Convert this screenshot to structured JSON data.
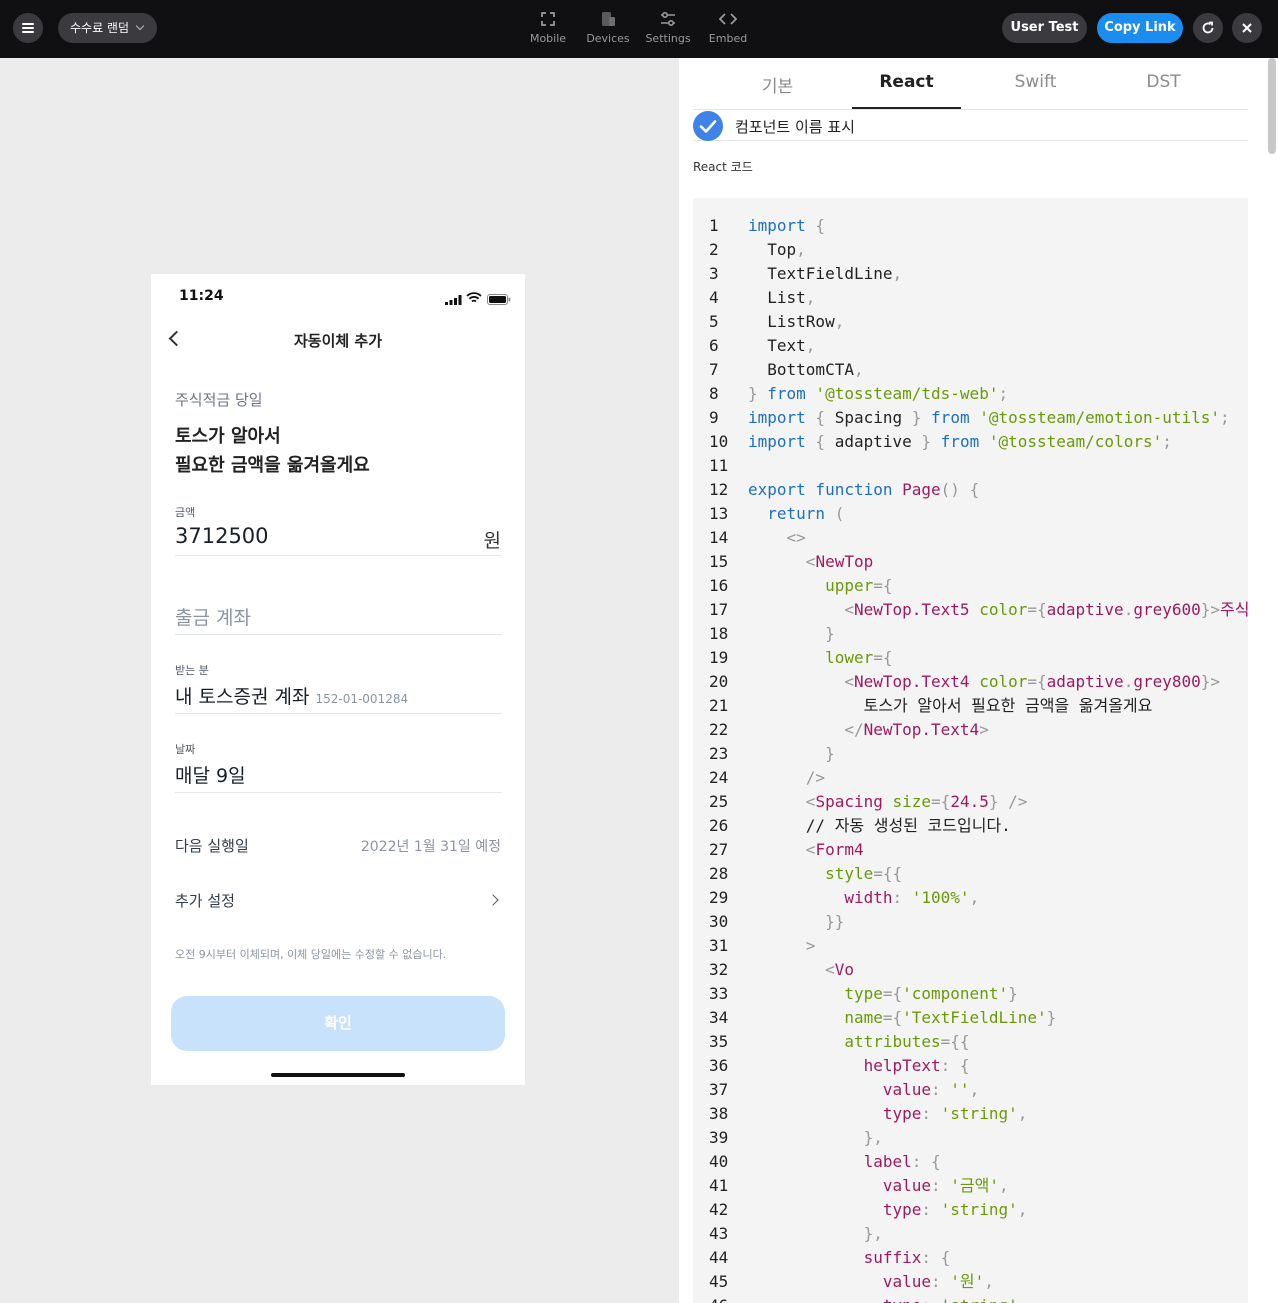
{
  "topbar": {
    "project_name": "수수료 랜덤",
    "tools": [
      {
        "label": "Mobile",
        "icon": "expand-icon"
      },
      {
        "label": "Devices",
        "icon": "devices-icon"
      },
      {
        "label": "Settings",
        "icon": "settings-sliders-icon"
      },
      {
        "label": "Embed",
        "icon": "code-brackets-icon"
      }
    ],
    "user_test_label": "User Test",
    "copy_link_label": "Copy Link"
  },
  "phone": {
    "status_time": "11:24",
    "nav_title": "자동이체 추가",
    "upper_text": "주식적금 당일",
    "lower_text_1": "토스가 알아서",
    "lower_text_2": "필요한 금액을 옮겨올게요",
    "amount_label": "금액",
    "amount_value": "3712500",
    "amount_suffix": "원",
    "withdraw_placeholder": "출금 계좌",
    "receiver_label": "받는 분",
    "receiver_value": "내 토스증권 계좌",
    "receiver_account": "152-01-001284",
    "date_label": "날짜",
    "date_value": "매달 9일",
    "next_run_label": "다음 실행일",
    "next_run_value": "2022년 1월 31일 예정",
    "extra_settings_label": "추가 설정",
    "notice": "오전 9시부터 이체되며, 이체 당일에는 수정할 수 없습니다.",
    "cta_label": "확인"
  },
  "panel": {
    "tabs": [
      "기본",
      "React",
      "Swift",
      "DST"
    ],
    "active_tab": "React",
    "show_component_names_label": "컴포넌트 이름 표시",
    "show_component_names_checked": true,
    "code_label": "React 코드"
  },
  "code_lines": [
    [
      [
        "k",
        "import"
      ],
      [
        "p",
        " {"
      ]
    ],
    [
      [
        "",
        "  Top"
      ],
      [
        "p",
        ","
      ]
    ],
    [
      [
        "",
        "  TextFieldLine"
      ],
      [
        "p",
        ","
      ]
    ],
    [
      [
        "",
        "  List"
      ],
      [
        "p",
        ","
      ]
    ],
    [
      [
        "",
        "  ListRow"
      ],
      [
        "p",
        ","
      ]
    ],
    [
      [
        "",
        "  Text"
      ],
      [
        "p",
        ","
      ]
    ],
    [
      [
        "",
        "  BottomCTA"
      ],
      [
        "p",
        ","
      ]
    ],
    [
      [
        "p",
        "} "
      ],
      [
        "k",
        "from"
      ],
      [
        "",
        ""
      ],
      [
        "s",
        " '@tossteam/tds-web'"
      ],
      [
        "p",
        ";"
      ]
    ],
    [
      [
        "k",
        "import"
      ],
      [
        "p",
        " { "
      ],
      [
        "",
        "Spacing"
      ],
      [
        "p",
        " } "
      ],
      [
        "k",
        "from"
      ],
      [
        "s",
        " '@tossteam/emotion-utils'"
      ],
      [
        "p",
        ";"
      ]
    ],
    [
      [
        "k",
        "import"
      ],
      [
        "p",
        " { "
      ],
      [
        "",
        "adaptive"
      ],
      [
        "p",
        " } "
      ],
      [
        "k",
        "from"
      ],
      [
        "s",
        " '@tossteam/colors'"
      ],
      [
        "p",
        ";"
      ]
    ],
    [],
    [
      [
        "k",
        "export function"
      ],
      [
        "t",
        " Page"
      ],
      [
        "p",
        "() {"
      ]
    ],
    [
      [
        "k",
        "  return"
      ],
      [
        "p",
        " ("
      ]
    ],
    [
      [
        "p",
        "    <>"
      ]
    ],
    [
      [
        "p",
        "      <"
      ],
      [
        "t",
        "NewTop"
      ]
    ],
    [
      [
        "s",
        "        upper"
      ],
      [
        "p",
        "={"
      ]
    ],
    [
      [
        "p",
        "          <"
      ],
      [
        "t",
        "NewTop.Text5"
      ],
      [
        "s",
        " color"
      ],
      [
        "p",
        "={"
      ],
      [
        "t",
        "adaptive"
      ],
      [
        "p",
        "."
      ],
      [
        "t",
        "grey600"
      ],
      [
        "p",
        "}>"
      ],
      [
        "t",
        "주식적금 당일"
      ]
    ],
    [
      [
        "p",
        "        }"
      ]
    ],
    [
      [
        "s",
        "        lower"
      ],
      [
        "p",
        "={"
      ]
    ],
    [
      [
        "p",
        "          <"
      ],
      [
        "t",
        "NewTop.Text4"
      ],
      [
        "s",
        " color"
      ],
      [
        "p",
        "={"
      ],
      [
        "t",
        "adaptive"
      ],
      [
        "p",
        "."
      ],
      [
        "t",
        "grey800"
      ],
      [
        "p",
        "}>"
      ]
    ],
    [
      [
        "",
        "            토스가 알아서 필요한 금액을 옮겨올게요"
      ]
    ],
    [
      [
        "p",
        "          </"
      ],
      [
        "t",
        "NewTop.Text4"
      ],
      [
        "p",
        ">"
      ]
    ],
    [
      [
        "p",
        "        }"
      ]
    ],
    [
      [
        "p",
        "      />"
      ]
    ],
    [
      [
        "p",
        "      <"
      ],
      [
        "t",
        "Spacing"
      ],
      [
        "s",
        " size"
      ],
      [
        "p",
        "={"
      ],
      [
        "t",
        "24.5"
      ],
      [
        "p",
        "} />"
      ]
    ],
    [
      [
        "",
        "      // 자동 생성된 코드입니다."
      ]
    ],
    [
      [
        "p",
        "      <"
      ],
      [
        "t",
        "Form4"
      ]
    ],
    [
      [
        "s",
        "        style"
      ],
      [
        "p",
        "={{"
      ]
    ],
    [
      [
        "t",
        "          width"
      ],
      [
        "p",
        ": "
      ],
      [
        "s",
        "'100%'"
      ],
      [
        "p",
        ","
      ]
    ],
    [
      [
        "p",
        "        }}"
      ]
    ],
    [
      [
        "p",
        "      >"
      ]
    ],
    [
      [
        "p",
        "        <"
      ],
      [
        "t",
        "Vo"
      ]
    ],
    [
      [
        "s",
        "          type"
      ],
      [
        "p",
        "={"
      ],
      [
        "s",
        "'component'"
      ],
      [
        "p",
        "}"
      ]
    ],
    [
      [
        "s",
        "          name"
      ],
      [
        "p",
        "={"
      ],
      [
        "s",
        "'TextFieldLine'"
      ],
      [
        "p",
        "}"
      ]
    ],
    [
      [
        "s",
        "          attributes"
      ],
      [
        "p",
        "={{"
      ]
    ],
    [
      [
        "t",
        "            helpText"
      ],
      [
        "p",
        ": {"
      ]
    ],
    [
      [
        "t",
        "              value"
      ],
      [
        "p",
        ": "
      ],
      [
        "s",
        "''"
      ],
      [
        "p",
        ","
      ]
    ],
    [
      [
        "t",
        "              type"
      ],
      [
        "p",
        ": "
      ],
      [
        "s",
        "'string'"
      ],
      [
        "p",
        ","
      ]
    ],
    [
      [
        "p",
        "            },"
      ]
    ],
    [
      [
        "t",
        "            label"
      ],
      [
        "p",
        ": {"
      ]
    ],
    [
      [
        "t",
        "              value"
      ],
      [
        "p",
        ": "
      ],
      [
        "s",
        "'금액'"
      ],
      [
        "p",
        ","
      ]
    ],
    [
      [
        "t",
        "              type"
      ],
      [
        "p",
        ": "
      ],
      [
        "s",
        "'string'"
      ],
      [
        "p",
        ","
      ]
    ],
    [
      [
        "p",
        "            },"
      ]
    ],
    [
      [
        "t",
        "            suffix"
      ],
      [
        "p",
        ": {"
      ]
    ],
    [
      [
        "t",
        "              value"
      ],
      [
        "p",
        ": "
      ],
      [
        "s",
        "'원'"
      ],
      [
        "p",
        ","
      ]
    ],
    [
      [
        "t",
        "              type"
      ],
      [
        "p",
        ": "
      ],
      [
        "s",
        "'string'"
      ],
      [
        "p",
        ","
      ]
    ]
  ]
}
